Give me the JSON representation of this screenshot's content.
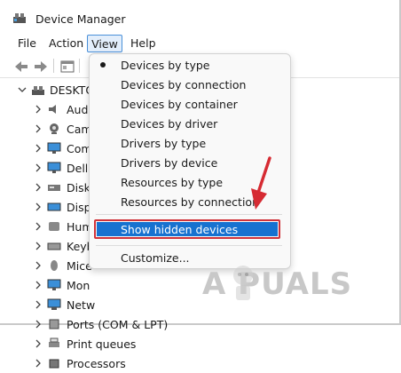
{
  "window": {
    "title": "Device Manager"
  },
  "menubar": {
    "items": [
      "File",
      "Action",
      "View",
      "Help"
    ]
  },
  "tree": {
    "root": "DESKTO",
    "items": [
      {
        "label": "Aud",
        "icon": "speaker-icon"
      },
      {
        "label": "Cam",
        "icon": "camera-icon"
      },
      {
        "label": "Com",
        "icon": "monitor-icon"
      },
      {
        "label": "DellU",
        "icon": "monitor-icon"
      },
      {
        "label": "Disk",
        "icon": "disk-drive-icon"
      },
      {
        "label": "Disp",
        "icon": "display-adapter-icon"
      },
      {
        "label": "Hum",
        "icon": "hid-icon"
      },
      {
        "label": "Keyb",
        "icon": "keyboard-icon"
      },
      {
        "label": "Mice",
        "icon": "mouse-icon"
      },
      {
        "label": "Mon",
        "icon": "monitor-icon"
      },
      {
        "label": "Netw",
        "icon": "network-icon"
      },
      {
        "label": "Ports (COM & LPT)",
        "icon": "port-icon"
      },
      {
        "label": "Print queues",
        "icon": "printer-icon"
      },
      {
        "label": "Processors",
        "icon": "processor-icon"
      }
    ]
  },
  "dropdown": {
    "items": [
      "Devices by type",
      "Devices by connection",
      "Devices by container",
      "Devices by driver",
      "Drivers by type",
      "Drivers by device",
      "Resources by type",
      "Resources by connection"
    ],
    "checked_index": 0,
    "highlighted": "Show hidden devices",
    "customize": "Customize..."
  },
  "watermark": {
    "text": "A  PUALS"
  },
  "colors": {
    "highlight": "#1772d0",
    "annotation": "#d0333a"
  }
}
